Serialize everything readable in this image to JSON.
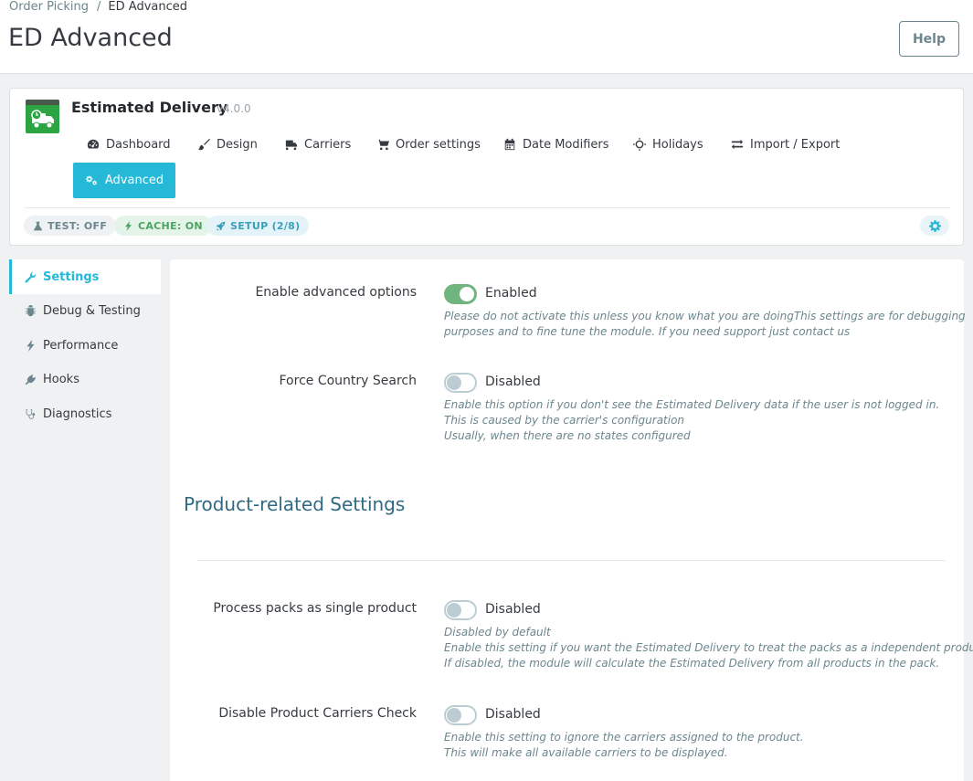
{
  "breadcrumb": {
    "parent": "Order Picking",
    "separator": "/",
    "current": "ED Advanced"
  },
  "page": {
    "title": "ED Advanced",
    "help_label": "Help"
  },
  "module": {
    "name": "Estimated Delivery",
    "version": "v4.0.0",
    "nav": [
      {
        "label": "Dashboard",
        "icon": "dashboard-icon"
      },
      {
        "label": "Design",
        "icon": "brush-icon"
      },
      {
        "label": "Carriers",
        "icon": "truck-icon"
      },
      {
        "label": "Order settings",
        "icon": "cart-icon"
      },
      {
        "label": "Date Modifiers",
        "icon": "calendar-icon"
      },
      {
        "label": "Holidays",
        "icon": "sun-icon"
      },
      {
        "label": "Import / Export",
        "icon": "exchange-icon"
      }
    ],
    "active_nav": {
      "label": "Advanced",
      "icon": "cogs-icon"
    },
    "badges": {
      "test": "TEST: OFF",
      "cache": "CACHE: ON",
      "setup": "SETUP (2/8)"
    }
  },
  "sidebar": {
    "items": [
      {
        "label": "Settings",
        "icon": "wrench-icon",
        "active": true
      },
      {
        "label": "Debug & Testing",
        "icon": "bug-icon",
        "active": false
      },
      {
        "label": "Performance",
        "icon": "bolt-icon",
        "active": false
      },
      {
        "label": "Hooks",
        "icon": "plug-icon",
        "active": false
      },
      {
        "label": "Diagnostics",
        "icon": "stethoscope-icon",
        "active": false
      }
    ]
  },
  "settings": {
    "advanced_options": {
      "label": "Enable advanced options",
      "state": "Enabled",
      "help": [
        "Please do not activate this unless you know what you are doingThis settings are for debugging",
        "purposes and to fine tune the module. If you need support just contact us"
      ]
    },
    "force_country": {
      "label": "Force Country Search",
      "state": "Disabled",
      "help": [
        "Enable this option if you don't see the Estimated Delivery data if the user is not logged in.",
        "This is caused by the carrier's configuration",
        "Usually, when there are no states configured"
      ]
    },
    "section_title": "Product-related Settings",
    "packs": {
      "label": "Process packs as single product",
      "state": "Disabled",
      "help": [
        "Disabled by default",
        "Enable this setting if you want the Estimated Delivery to treat the packs as a independent product.",
        "If disabled, the module will calculate the Estimated Delivery from all products in the pack."
      ]
    },
    "carriers_check": {
      "label": "Disable Product Carriers Check",
      "state": "Disabled",
      "help": [
        "Enable this setting to ignore the carriers assigned to the product.",
        "This will make all available carriers to be displayed."
      ]
    }
  },
  "colors": {
    "accent": "#25b9d7",
    "switch_on": "#70b580",
    "section_title": "#2f6a82"
  }
}
